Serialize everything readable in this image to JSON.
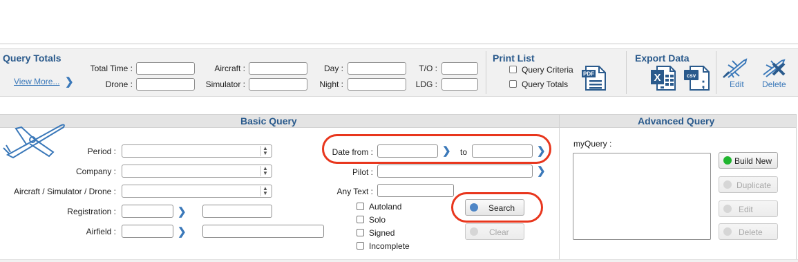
{
  "query_totals": {
    "title": "Query Totals",
    "view_more": "View More...",
    "labels": {
      "total_time": "Total Time :",
      "drone": "Drone :",
      "aircraft": "Aircraft :",
      "simulator": "Simulator :",
      "day": "Day :",
      "night": "Night :",
      "to": "T/O :",
      "ldg": "LDG :"
    }
  },
  "print_list": {
    "title": "Print List",
    "options": [
      "Query Criteria",
      "Query Totals"
    ]
  },
  "export_data": {
    "title": "Export Data"
  },
  "tools": {
    "edit": "Edit",
    "delete": "Delete"
  },
  "basic_query": {
    "title": "Basic Query",
    "labels": {
      "period": "Period :",
      "company": "Company :",
      "aircraft": "Aircraft / Simulator / Drone :",
      "registration": "Registration :",
      "airfield": "Airfield :",
      "date_from": "Date from :",
      "to": "to",
      "pilot": "Pilot :",
      "any_text": "Any Text :"
    },
    "checkboxes": [
      "Autoland",
      "Solo",
      "Signed",
      "Incomplete"
    ],
    "search": "Search",
    "clear": "Clear"
  },
  "advanced_query": {
    "title": "Advanced Query",
    "my_query": "myQuery :",
    "buttons": {
      "build_new": "Build New",
      "duplicate": "Duplicate",
      "edit": "Edit",
      "delete": "Delete"
    }
  },
  "colors": {
    "accent": "#3a78b9",
    "heading": "#2a5a8c",
    "highlight_ring": "#e8361d",
    "build_new_dot": "#1fb52e",
    "search_dot": "#4f86c6"
  }
}
